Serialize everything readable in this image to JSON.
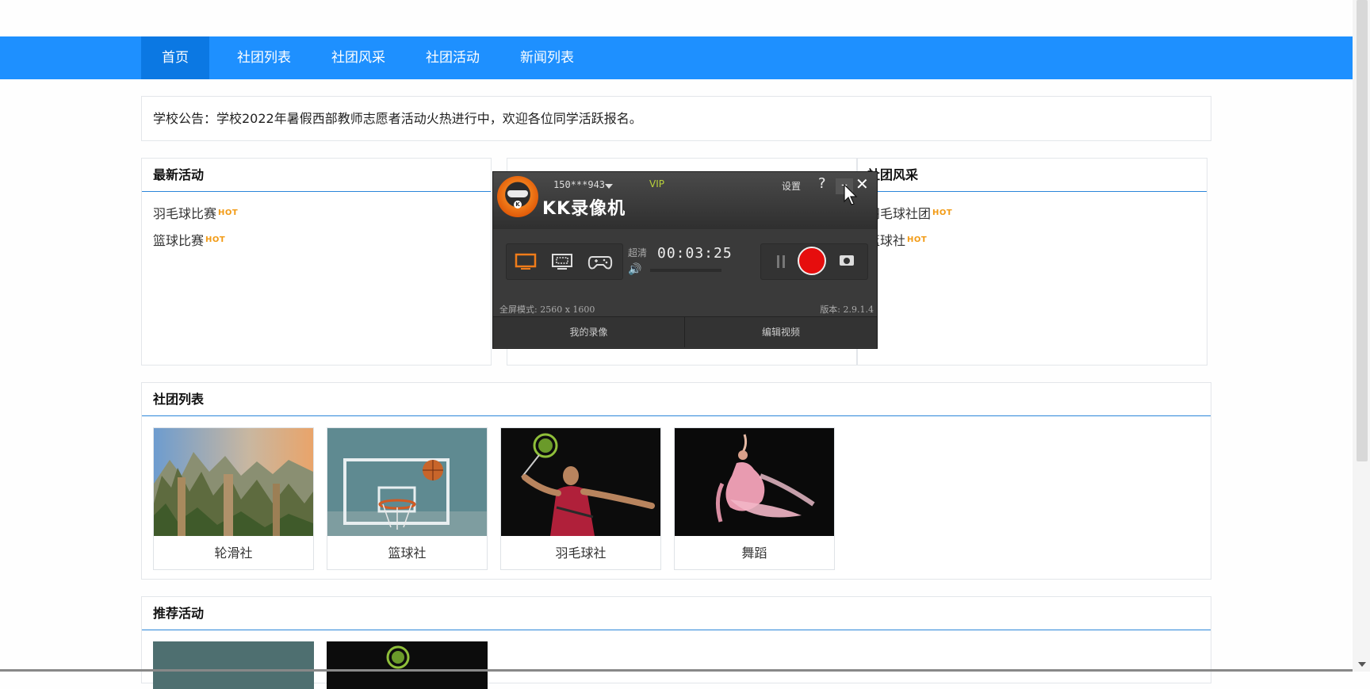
{
  "nav": {
    "items": [
      {
        "label": "首页",
        "active": true
      },
      {
        "label": "社团列表"
      },
      {
        "label": "社团风采"
      },
      {
        "label": "社团活动"
      },
      {
        "label": "新闻列表"
      }
    ]
  },
  "notice": {
    "text": "学校公告：学校2022年暑假西部教师志愿者活动火热进行中，欢迎各位同学活跃报名。"
  },
  "latest_activity": {
    "title": "最新活动",
    "items": [
      "羽毛球比赛",
      "篮球比赛"
    ],
    "hot_label": "HOT"
  },
  "club_showcase": {
    "title": "社团风采",
    "items": [
      "羽毛球社团",
      "篮球社"
    ],
    "hot_label": "HOT"
  },
  "club_list": {
    "title": "社团列表",
    "cards": [
      {
        "label": "轮滑社",
        "image": "mountain-landscape"
      },
      {
        "label": "篮球社",
        "image": "basketball-hoop"
      },
      {
        "label": "羽毛球社",
        "image": "badminton-player"
      },
      {
        "label": "舞蹈",
        "image": "dancer"
      }
    ]
  },
  "recommended": {
    "title": "推荐活动"
  },
  "recorder": {
    "user": "150***943",
    "vip": "VIP",
    "settings": "设置",
    "help": "?",
    "minimize": "–",
    "close": "✕",
    "title": "KK录像机",
    "quality": "超清",
    "timer": "00:03:25",
    "mode_info": "全屏模式: 2560 x 1600",
    "version": "版本: 2.9.1.4",
    "my_recordings": "我的录像",
    "edit_video": "编辑视频",
    "logo_letter": "K",
    "accent_color": "#f07c1a",
    "record_color": "#e60d0d"
  },
  "colors": {
    "nav_bg": "#1e90ff",
    "nav_active": "#0b78e3",
    "rule": "#2b86d9",
    "hot": "#f29b16"
  }
}
